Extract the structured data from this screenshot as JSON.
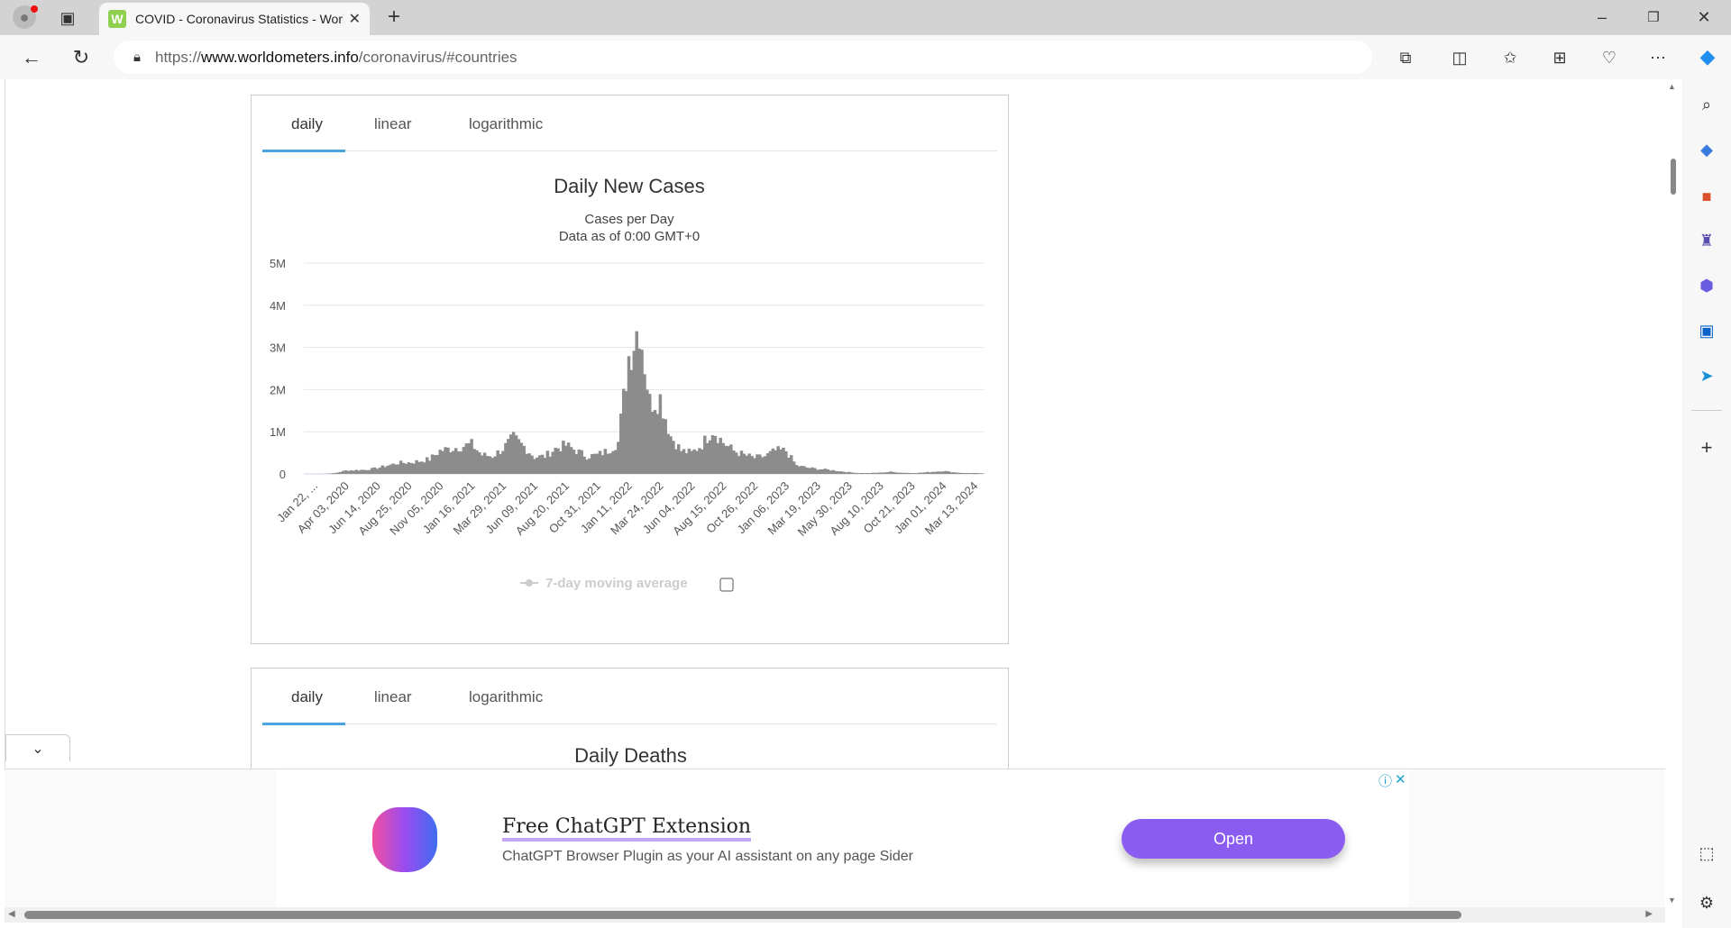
{
  "browser": {
    "tab_title": "COVID - Coronavirus Statistics - Worldometer",
    "tab_title_visible": "COVID - Coronavirus Statistics - \\",
    "favicon_letter": "W",
    "url_prefix": "https://",
    "url_domain": "www.worldometers.info",
    "url_path": "/coronavirus/#countries"
  },
  "card1": {
    "tabs": [
      "daily",
      "linear",
      "logarithmic"
    ],
    "active_tab": "daily",
    "legend": "7-day moving average"
  },
  "card2": {
    "tabs": [
      "daily",
      "linear",
      "logarithmic"
    ],
    "active_tab": "daily",
    "title": "Daily Deaths"
  },
  "ad": {
    "title": "Free ChatGPT Extension",
    "description": "ChatGPT Browser Plugin as your AI assistant on any page Sider",
    "button": "Open",
    "info": "ⓘ",
    "close": "✕"
  },
  "colors": {
    "accent": "#4aa3df",
    "bar": "#8c8c8c",
    "ad_button": "#8a5cf0"
  },
  "chart_data": {
    "type": "bar",
    "title": "Daily New Cases",
    "subtitle": "Cases per Day",
    "subtitle2": "Data as of 0:00 GMT+0",
    "xlabel": "",
    "ylabel": "",
    "ylim": [
      0,
      5000000
    ],
    "yticks": [
      "0",
      "1M",
      "2M",
      "3M",
      "4M",
      "5M"
    ],
    "xtick_labels": [
      "Jan 22, ...",
      "Apr 03, 2020",
      "Jun 14, 2020",
      "Aug 25, 2020",
      "Nov 05, 2020",
      "Jan 16, 2021",
      "Mar 29, 2021",
      "Jun 09, 2021",
      "Aug 20, 2021",
      "Oct 31, 2021",
      "Jan 11, 2022",
      "Mar 24, 2022",
      "Jun 04, 2022",
      "Aug 15, 2022",
      "Oct 26, 2022",
      "Jan 06, 2023",
      "Mar 19, 2023",
      "May 30, 2023",
      "Aug 10, 2023",
      "Oct 21, 2023",
      "Jan 01, 2024",
      "Mar 13, 2024"
    ],
    "sample_step_days": 24,
    "values_millions": [
      0,
      0.002,
      0.02,
      0.08,
      0.09,
      0.1,
      0.14,
      0.2,
      0.26,
      0.27,
      0.3,
      0.35,
      0.55,
      0.6,
      0.65,
      0.7,
      0.45,
      0.42,
      0.6,
      0.85,
      0.65,
      0.4,
      0.42,
      0.6,
      0.68,
      0.55,
      0.42,
      0.45,
      0.55,
      0.75,
      2.8,
      3.6,
      1.7,
      1.8,
      0.9,
      0.55,
      0.5,
      0.7,
      1.05,
      0.75,
      0.55,
      0.45,
      0.38,
      0.42,
      0.55,
      0.55,
      0.2,
      0.15,
      0.12,
      0.1,
      0.07,
      0.04,
      0.02,
      0.02,
      0.03,
      0.05,
      0.03,
      0.02,
      0.03,
      0.05,
      0.07,
      0.04,
      0.02,
      0.02,
      0.01
    ],
    "grid": true,
    "legend": "bottom"
  }
}
